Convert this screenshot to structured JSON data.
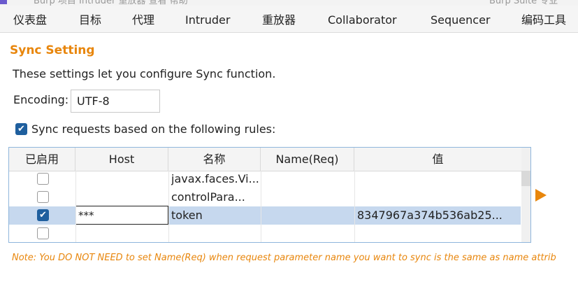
{
  "window": {
    "ghost_title": "Burp   项目   Intruder   重放器   查看   帮助",
    "ghost_right": "Burp Suite 专业"
  },
  "tabs": [
    {
      "label": "仪表盘"
    },
    {
      "label": "目标"
    },
    {
      "label": "代理"
    },
    {
      "label": "Intruder"
    },
    {
      "label": "重放器"
    },
    {
      "label": "Collaborator"
    },
    {
      "label": "Sequencer"
    },
    {
      "label": "编码工具"
    }
  ],
  "sync": {
    "title": "Sync Setting",
    "description": "These settings let you configure Sync function.",
    "encoding_label": "Encoding:",
    "encoding_value": "UTF-8",
    "rules_checkbox_label": "Sync requests based on the following rules:",
    "rules_checked": true
  },
  "table": {
    "columns": [
      "已启用",
      "Host",
      "名称",
      "Name(Req)",
      "值"
    ],
    "rows": [
      {
        "enabled": false,
        "host": "",
        "name": "javax.faces.Vi...",
        "name_req": "",
        "value": ""
      },
      {
        "enabled": false,
        "host": "",
        "name": "controlPara...",
        "name_req": "",
        "value": ""
      },
      {
        "enabled": true,
        "host": "***",
        "name": "token",
        "name_req": "",
        "value": "8347967a374b536ab25..."
      },
      {
        "enabled": false,
        "host": "",
        "name": "",
        "name_req": "",
        "value": ""
      }
    ]
  },
  "note": "Note: You DO NOT NEED to set Name(Req) when request parameter name you want to sync is the same as name attrib",
  "icons": {
    "check": "checkmark-icon",
    "play": "play-icon"
  },
  "colors": {
    "accent": "#e8860c",
    "check_fill": "#1f5f9e",
    "selected_row": "#c6d8ee",
    "table_border": "#8fb6dc"
  }
}
